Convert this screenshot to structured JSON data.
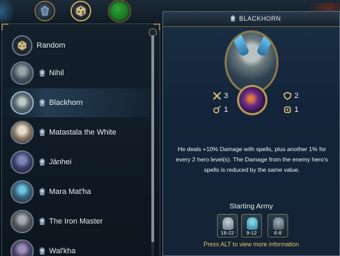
{
  "top_bar": {
    "buttons": [
      {
        "name": "faction-button",
        "icon": "faction-emblem-icon"
      },
      {
        "name": "random-dice-button",
        "icon": "dice-icon"
      },
      {
        "name": "green-status-button",
        "icon": "green-orb-icon"
      }
    ]
  },
  "hero_list": {
    "items": [
      {
        "label": "Random",
        "icon": "dice-icon",
        "selected": false
      },
      {
        "label": "Nihil",
        "icon": "necropolis-faction-icon",
        "selected": false
      },
      {
        "label": "Blackhorn",
        "icon": "necropolis-faction-icon",
        "selected": true
      },
      {
        "label": "Matastala the White",
        "icon": "necropolis-faction-icon",
        "selected": false
      },
      {
        "label": "Jānhei",
        "icon": "necropolis-faction-icon",
        "selected": false
      },
      {
        "label": "Mara Mat'ha",
        "icon": "necropolis-faction-icon",
        "selected": false
      },
      {
        "label": "The Iron Master",
        "icon": "necropolis-faction-icon",
        "selected": false
      },
      {
        "label": "Wal'kha",
        "icon": "necropolis-faction-icon",
        "selected": false
      }
    ]
  },
  "detail": {
    "title": "BLACKHORN",
    "stats": {
      "attack": "3",
      "defense": "2",
      "spellpower": "1",
      "knowledge": "1"
    },
    "description": "He deals +10% Damage with spells, plus another 1% for every 2 hero level(s). The Damage from the enemy hero's spells is reduced by the same value.",
    "army_label": "Starting Army",
    "army": [
      {
        "count": "16-22",
        "color": "#9aa7b0"
      },
      {
        "count": "9-12",
        "color": "#58c0d8"
      },
      {
        "count": "6-8",
        "color": "#6f7c88"
      }
    ],
    "hint": "Press ALT to view more information"
  },
  "colors": {
    "panel_bg": "#13202c",
    "detail_bg": "#1a2f44",
    "gold_border": "#8c7a4e",
    "hint_text": "#e0c768"
  }
}
